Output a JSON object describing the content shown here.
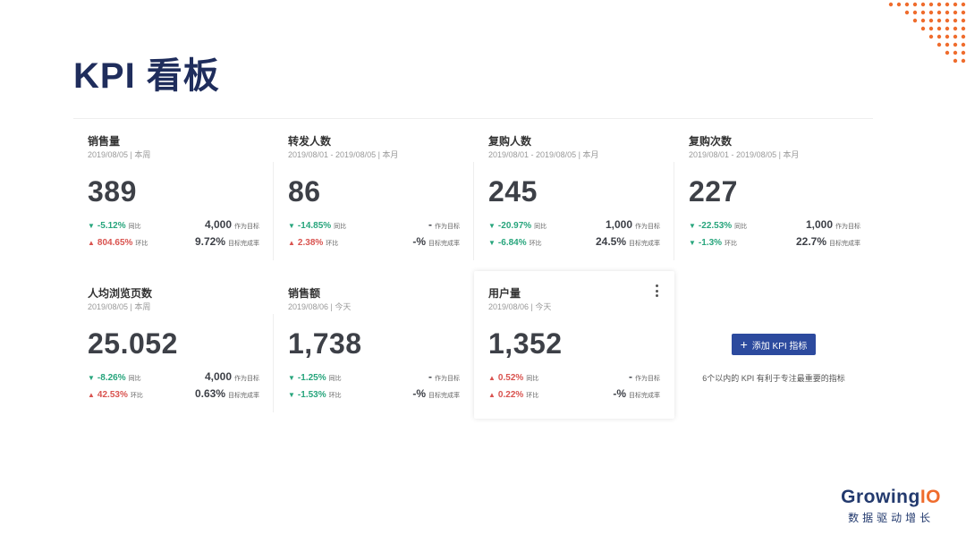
{
  "title": "KPI 看板",
  "cards": [
    {
      "name": "销售量",
      "sub": "2019/08/05 | 本周",
      "value": "389",
      "r1_dir": "down",
      "r1_arrow": "▼",
      "r1_pct": "-5.12%",
      "r1_tag": "同比",
      "r1_val": "4,000",
      "r1_label": "作为目标",
      "r2_dir": "up",
      "r2_arrow": "▲",
      "r2_pct": "804.65%",
      "r2_tag": "环比",
      "r2_val": "9.72%",
      "r2_label": "目标完成率"
    },
    {
      "name": "转发人数",
      "sub": "2019/08/01 - 2019/08/05 | 本月",
      "value": "86",
      "r1_dir": "down",
      "r1_arrow": "▼",
      "r1_pct": "-14.85%",
      "r1_tag": "同比",
      "r1_val": "-",
      "r1_label": "作为目标",
      "r2_dir": "up",
      "r2_arrow": "▲",
      "r2_pct": "2.38%",
      "r2_tag": "环比",
      "r2_val": "-%",
      "r2_label": "目标完成率"
    },
    {
      "name": "复购人数",
      "sub": "2019/08/01 - 2019/08/05 | 本月",
      "value": "245",
      "r1_dir": "down",
      "r1_arrow": "▼",
      "r1_pct": "-20.97%",
      "r1_tag": "同比",
      "r1_val": "1,000",
      "r1_label": "作为目标",
      "r2_dir": "down",
      "r2_arrow": "▼",
      "r2_pct": "-6.84%",
      "r2_tag": "环比",
      "r2_val": "24.5%",
      "r2_label": "目标完成率"
    },
    {
      "name": "复购次数",
      "sub": "2019/08/01 - 2019/08/05 | 本月",
      "value": "227",
      "r1_dir": "down",
      "r1_arrow": "▼",
      "r1_pct": "-22.53%",
      "r1_tag": "同比",
      "r1_val": "1,000",
      "r1_label": "作为目标",
      "r2_dir": "down",
      "r2_arrow": "▼",
      "r2_pct": "-1.3%",
      "r2_tag": "环比",
      "r2_val": "22.7%",
      "r2_label": "目标完成率"
    },
    {
      "name": "人均浏览页数",
      "sub": "2019/08/05 | 本周",
      "value": "25.052",
      "r1_dir": "down",
      "r1_arrow": "▼",
      "r1_pct": "-8.26%",
      "r1_tag": "同比",
      "r1_val": "4,000",
      "r1_label": "作为目标",
      "r2_dir": "up",
      "r2_arrow": "▲",
      "r2_pct": "42.53%",
      "r2_tag": "环比",
      "r2_val": "0.63%",
      "r2_label": "目标完成率"
    },
    {
      "name": "销售额",
      "sub": "2019/08/06 | 今天",
      "value": "1,738",
      "r1_dir": "down",
      "r1_arrow": "▼",
      "r1_pct": "-1.25%",
      "r1_tag": "同比",
      "r1_val": "-",
      "r1_label": "作为目标",
      "r2_dir": "down",
      "r2_arrow": "▼",
      "r2_pct": "-1.53%",
      "r2_tag": "环比",
      "r2_val": "-%",
      "r2_label": "目标完成率"
    },
    {
      "name": "用户量",
      "sub": "2019/08/06 | 今天",
      "value": "1,352",
      "r1_dir": "up",
      "r1_arrow": "▲",
      "r1_pct": "0.52%",
      "r1_tag": "同比",
      "r1_val": "-",
      "r1_label": "作为目标",
      "r2_dir": "up",
      "r2_arrow": "▲",
      "r2_pct": "0.22%",
      "r2_tag": "环比",
      "r2_val": "-%",
      "r2_label": "目标完成率"
    }
  ],
  "add_button": {
    "icon": "plus-icon",
    "label": "添加 KPI 指标"
  },
  "add_hint": "6个以内的 KPI 有利于专注最重要的指标",
  "logo": {
    "name_a": "Growing",
    "name_b": "IO",
    "tagline": "数据驱动增长"
  },
  "colors": {
    "down": "#27a57c",
    "up": "#d9534f",
    "title": "#1f2d5c",
    "button": "#2c4a9e",
    "logo_accent": "#ef6c2d"
  }
}
